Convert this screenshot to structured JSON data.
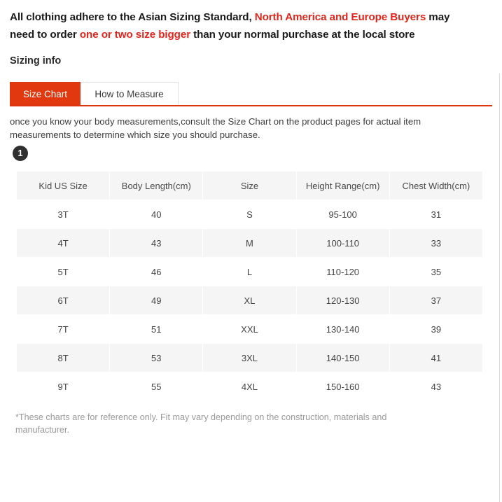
{
  "intro": {
    "line1_part1": "All clothing adhere to the Asian Sizing Standard, ",
    "line1_highlight": "North America and Europe Buyers",
    "line1_part2": " may",
    "line2_part1": "need to order ",
    "line2_highlight": "one or two size bigger",
    "line2_part2": " than your normal purchase at the local store",
    "highlight_color": "#e1251b"
  },
  "section": {
    "heading": "Sizing info"
  },
  "tabs": {
    "active_index": 0,
    "items": [
      {
        "label": "Size Chart",
        "active": true
      },
      {
        "label": "How to Measure",
        "active": false
      }
    ],
    "active_color": "#e1380f",
    "underline_color": "#de3412"
  },
  "instructions": {
    "text": "once you know your body measurements,consult the Size Chart on the product pages for actual item measurements to determine which size you should purchase."
  },
  "step_badge": {
    "number": "1"
  },
  "chart_data": {
    "type": "table",
    "title": "Size Chart",
    "columns": [
      "Kid US Size",
      "Body Length(cm)",
      "Size",
      "Height Range(cm)",
      "Chest Width(cm)"
    ],
    "rows": [
      [
        "3T",
        "40",
        "S",
        "95-100",
        "31"
      ],
      [
        "4T",
        "43",
        "M",
        "100-110",
        "33"
      ],
      [
        "5T",
        "46",
        "L",
        "110-120",
        "35"
      ],
      [
        "6T",
        "49",
        "XL",
        "120-130",
        "37"
      ],
      [
        "7T",
        "51",
        "XXL",
        "130-140",
        "39"
      ],
      [
        "8T",
        "53",
        "3XL",
        "140-150",
        "41"
      ],
      [
        "9T",
        "55",
        "4XL",
        "150-160",
        "43"
      ]
    ]
  },
  "footnote": {
    "text": "*These charts are for reference only. Fit may vary depending on the construction, materials and manufacturer."
  }
}
